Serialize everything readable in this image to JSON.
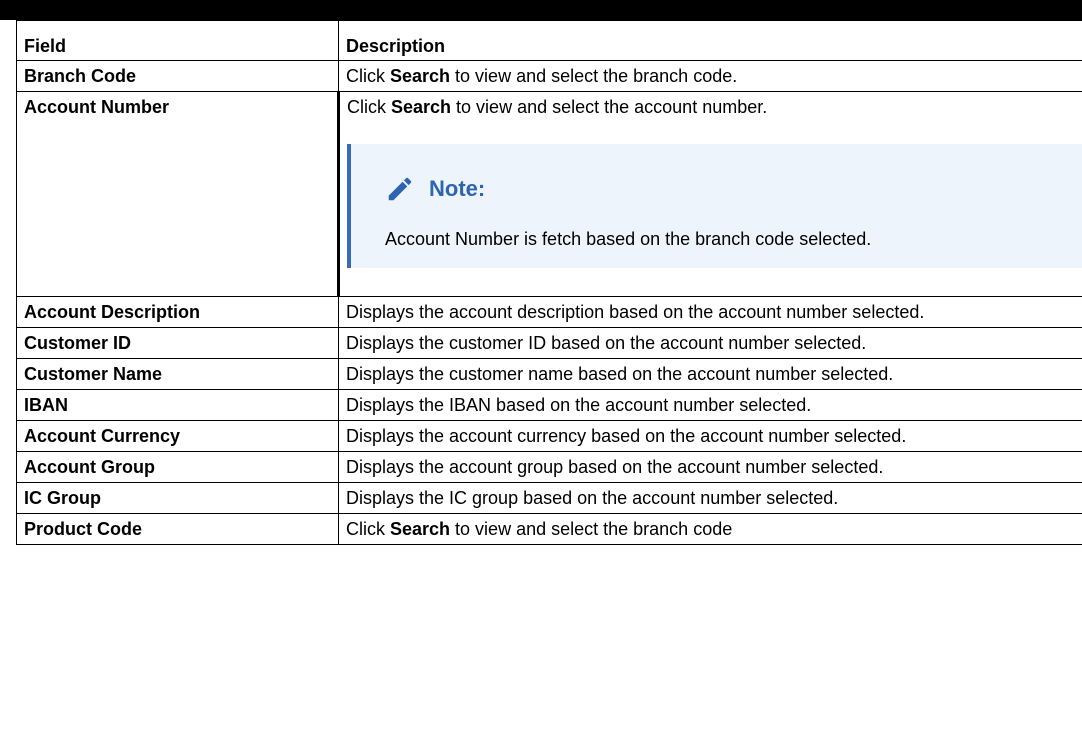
{
  "table": {
    "header": {
      "field": "Field",
      "description": "Description"
    },
    "rows": [
      {
        "field": "Branch Code",
        "pre": "Click ",
        "bold": "Search",
        "post": " to view and select the branch code."
      },
      {
        "field": "Account Number",
        "pre": "Click ",
        "bold": "Search",
        "post": " to view and select the account number."
      },
      {
        "field": "Account Description",
        "text": "Displays the account description based on the account number selected."
      },
      {
        "field": "Customer ID",
        "text": "Displays the customer ID based on the account number selected."
      },
      {
        "field": "Customer Name",
        "text": "Displays the customer name based on the account number selected."
      },
      {
        "field": "IBAN",
        "text": "Displays the IBAN based on the account number selected."
      },
      {
        "field": "Account Currency",
        "text": "Displays the account currency based on the account number selected."
      },
      {
        "field": "Account Group",
        "text": "Displays the account group based on the account number selected."
      },
      {
        "field": "IC Group",
        "text": "Displays the IC group based on the account number selected."
      },
      {
        "field": "Product Code",
        "pre": "Click ",
        "bold": "Search",
        "post": " to view and select the branch code"
      }
    ]
  },
  "note": {
    "title": "Note:",
    "text": "Account Number is fetch based on the branch code selected.",
    "icon": "pencil-icon",
    "accent": "#3b6ab7"
  }
}
